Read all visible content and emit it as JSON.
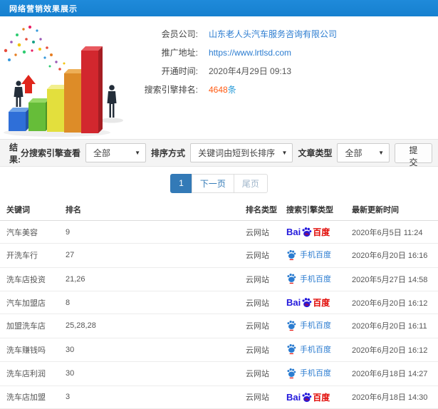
{
  "header": {
    "title": "网络营销效果展示",
    "bg_color": "#1680cf"
  },
  "info": {
    "rows": [
      {
        "label": "会员公司:",
        "value": "山东老人头汽车服务咨询有限公司"
      },
      {
        "label": "推广地址:",
        "value": "https://www.lrtlsd.com"
      },
      {
        "label": "开通时间:",
        "value": "2020年4月29日 09:13"
      },
      {
        "label": "搜索引擎排名:",
        "value": "4648",
        "suffix": "条"
      }
    ]
  },
  "filters": {
    "result_label": "结果:",
    "engine_label": "分搜索引擎查看",
    "engine_value": "全部",
    "sort_label": "排序方式",
    "sort_value": "关键词由短到长排序",
    "article_label": "文章类型",
    "article_value": "全部",
    "submit_label": "提交",
    "caret": "▼"
  },
  "pagination": {
    "current": "1",
    "next_label": "下一页",
    "last_label": "尾页"
  },
  "engines": {
    "baidu": {
      "part1": "Bai",
      "du": "du",
      "part2": "百度"
    },
    "mobile": {
      "label": "手机百度"
    }
  },
  "table": {
    "headers": [
      "关键词",
      "排名",
      "排名类型",
      "搜索引擎类型",
      "最新更新时间"
    ],
    "rows": [
      {
        "keyword": "汽车美容",
        "rank": "9",
        "rank_type": "云网站",
        "engine": "baidu",
        "updated": "2020年6月5日 11:24"
      },
      {
        "keyword": "开洗车行",
        "rank": "27",
        "rank_type": "云网站",
        "engine": "mobile",
        "updated": "2020年6月20日 16:16"
      },
      {
        "keyword": "洗车店投资",
        "rank": "21,26",
        "rank_type": "云网站",
        "engine": "mobile",
        "updated": "2020年5月27日 14:58"
      },
      {
        "keyword": "汽车加盟店",
        "rank": "8",
        "rank_type": "云网站",
        "engine": "baidu",
        "updated": "2020年6月20日 16:12"
      },
      {
        "keyword": "加盟洗车店",
        "rank": "25,28,28",
        "rank_type": "云网站",
        "engine": "mobile",
        "updated": "2020年6月20日 16:11"
      },
      {
        "keyword": "洗车赚钱吗",
        "rank": "30",
        "rank_type": "云网站",
        "engine": "mobile",
        "updated": "2020年6月20日 16:12"
      },
      {
        "keyword": "洗车店利润",
        "rank": "30",
        "rank_type": "云网站",
        "engine": "mobile",
        "updated": "2020年6月18日 14:27"
      },
      {
        "keyword": "洗车店加盟",
        "rank": "3",
        "rank_type": "云网站",
        "engine": "baidu",
        "updated": "2020年6月18日 14:30"
      }
    ]
  },
  "colors": {
    "header_bg": "#1680cf",
    "link_blue": "#2b7cd0",
    "highlight_orange": "#ff5a12",
    "pagination_active": "#337ab7",
    "baidu_blue": "#2319dc",
    "baidu_red": "#e10602"
  }
}
